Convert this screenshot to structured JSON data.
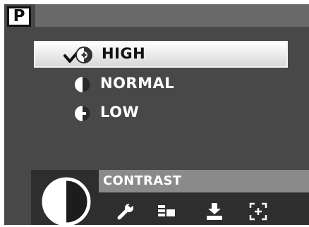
{
  "mode_badge": "P",
  "menu": {
    "options": [
      {
        "label": "HIGH",
        "selected": true,
        "icon": "contrast-high-icon"
      },
      {
        "label": "NORMAL",
        "selected": false,
        "icon": "contrast-normal-icon"
      },
      {
        "label": "LOW",
        "selected": false,
        "icon": "contrast-low-icon"
      }
    ],
    "check_icon": "checkmark-icon"
  },
  "bottom": {
    "title": "CONTRAST",
    "main_icon": "contrast-icon",
    "tabs": [
      "wrench-icon",
      "grid-icon",
      "download-icon",
      "focus-frame-icon"
    ]
  },
  "colors": {
    "background": "#484848",
    "topbar": "#6a6a6a",
    "selected_bar": "#ffffff",
    "panel": "#2e2e2e",
    "title_bar": "#8a8a8a",
    "text": "#ffffff"
  }
}
